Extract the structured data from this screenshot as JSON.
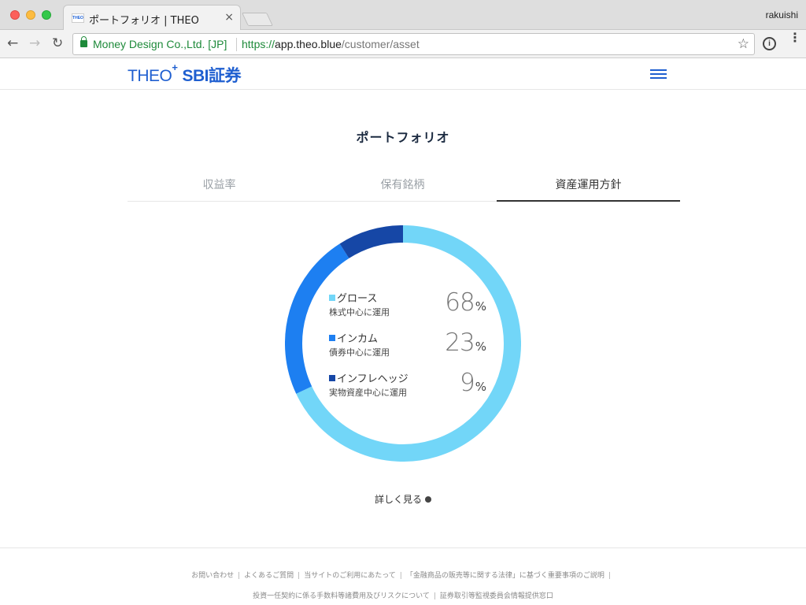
{
  "browser": {
    "tab_title": "ポートフォリオ | THEO",
    "tab_favicon": "THEO",
    "tab_close": "×",
    "profile_name": "rakuishi",
    "ev_name": "Money Design Co.,Ltd. [JP]",
    "url_scheme": "https://",
    "url_host": "app.theo.blue",
    "url_path": "/customer/asset",
    "back": "←",
    "forward": "→",
    "reload": "↻",
    "star": "☆",
    "ext_label": "i",
    "menu": "⋮"
  },
  "header": {
    "logo_theo": "THEO",
    "logo_plus": "+",
    "logo_sbi": "SBI証券"
  },
  "main": {
    "title": "ポートフォリオ",
    "tabs": [
      {
        "label": "収益率"
      },
      {
        "label": "保有銘柄"
      },
      {
        "label": "資産運用方針"
      }
    ],
    "legend": [
      {
        "name": "グロース",
        "desc": "株式中心に運用",
        "pct": "68",
        "unit": "%",
        "color": "#72d6f8"
      },
      {
        "name": "インカム",
        "desc": "債券中心に運用",
        "pct": "23",
        "unit": "%",
        "color": "#1d7ff1"
      },
      {
        "name": "インフレヘッジ",
        "desc": "実物資産中心に運用",
        "pct": "9",
        "unit": "%",
        "color": "#1647a6"
      }
    ],
    "detail_link": "詳しく見る"
  },
  "chart_data": {
    "type": "pie",
    "categories": [
      "グロース",
      "インカム",
      "インフレヘッジ"
    ],
    "values": [
      68,
      23,
      9
    ],
    "colors": [
      "#72d6f8",
      "#1d7ff1",
      "#1647a6"
    ],
    "style": "donut"
  },
  "footer": {
    "row1": [
      "お問い合わせ",
      "よくあるご質問",
      "当サイトのご利用にあたって",
      "「金融商品の販売等に関する法律」に基づく重要事項のご説明"
    ],
    "row2": [
      "投資一任契約に係る手数料等諸費用及びリスクについて",
      "証券取引等監視委員会情報提供窓口"
    ],
    "separator": "|"
  }
}
